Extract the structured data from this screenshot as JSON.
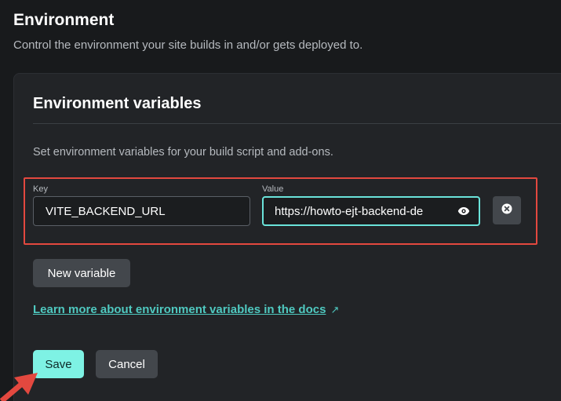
{
  "section": {
    "title": "Environment",
    "description": "Control the environment your site builds in and/or gets deployed to."
  },
  "card": {
    "title": "Environment variables",
    "description": "Set environment variables for your build script and add-ons."
  },
  "variable": {
    "key_label": "Key",
    "key_value": "VITE_BACKEND_URL",
    "value_label": "Value",
    "value_value": "https://howto-ejt-backend-de"
  },
  "actions": {
    "new_variable_label": "New variable",
    "docs_link_label": "Learn more about environment variables in the docs",
    "docs_link_icon": "↗",
    "save_label": "Save",
    "cancel_label": "Cancel"
  },
  "colors": {
    "accent": "#7ef2e4",
    "link": "#4fc9c0",
    "annotation": "#e3483f"
  },
  "icons": {
    "reveal": "eye-icon",
    "remove": "close-circle-icon",
    "external": "external-link-icon",
    "annotation": "arrow-icon"
  }
}
